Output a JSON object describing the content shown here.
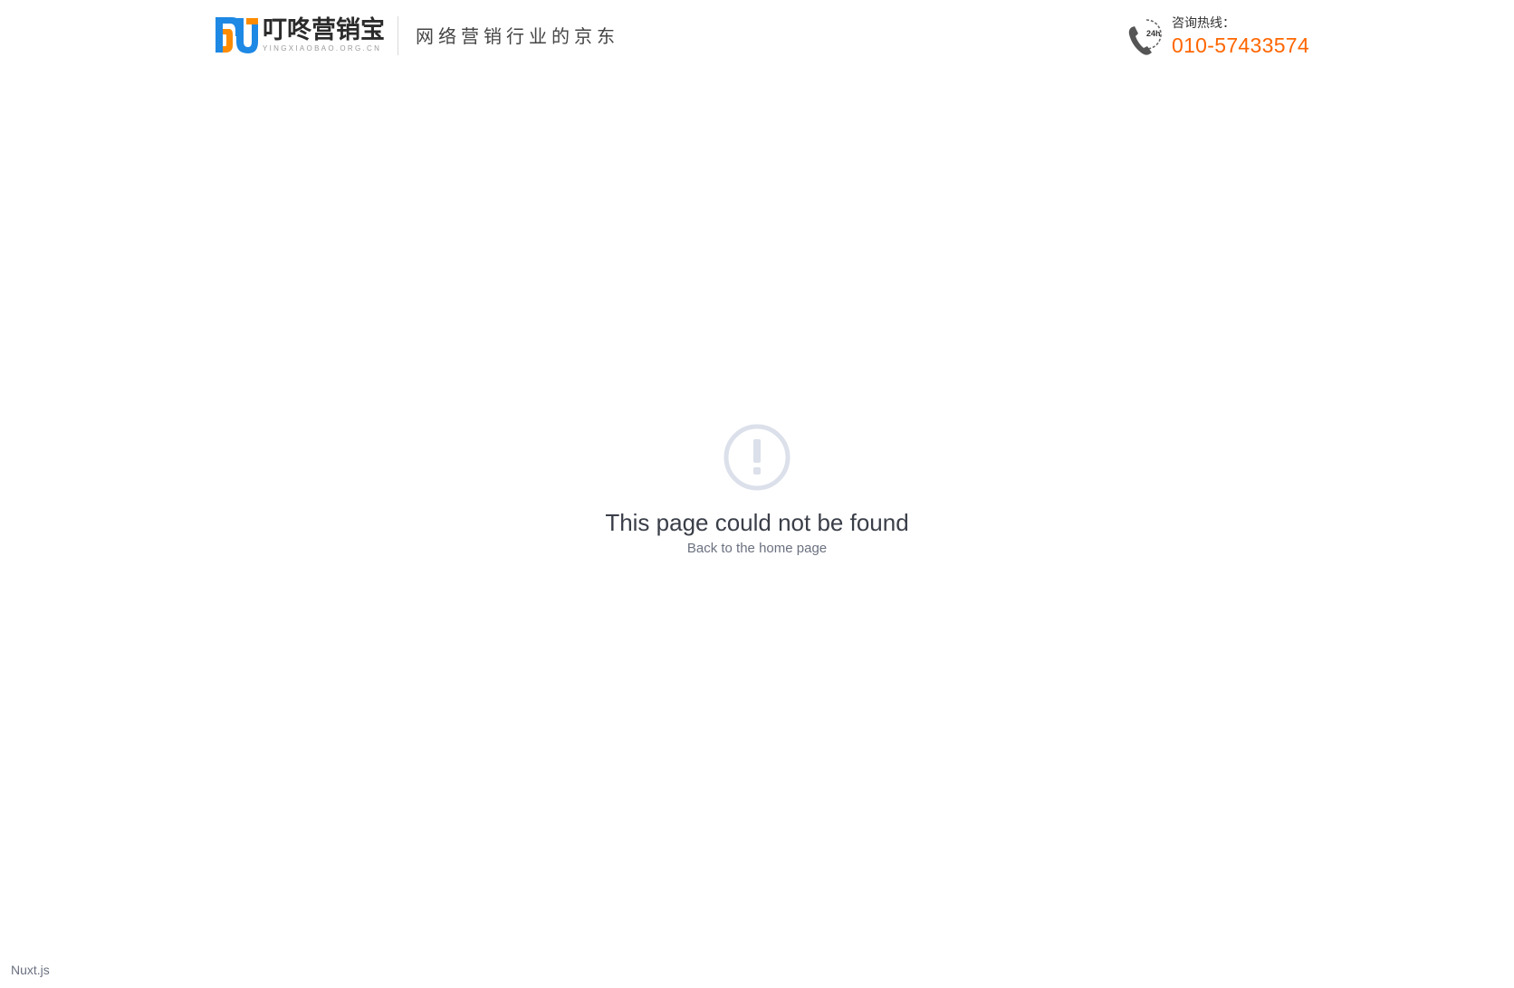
{
  "header": {
    "logo": {
      "name": "叮咚营销宝",
      "domain": "YINGXIAOBAO.ORG.CN",
      "colors": {
        "blue": "#1e88e5",
        "orange": "#ff8c00"
      }
    },
    "slogan": "网络营销行业的京东",
    "hotline": {
      "icon": "phone-24h-icon",
      "icon_badge": "24h",
      "label": "咨询热线：",
      "number": "010-57433574",
      "number_color": "#ff6600"
    }
  },
  "error": {
    "icon": "exclamation-circle-icon",
    "icon_color": "#dbe0ea",
    "title": "This page could not be found",
    "link_label": "Back to the home page"
  },
  "footer": {
    "nuxt_label": "Nuxt.js"
  }
}
